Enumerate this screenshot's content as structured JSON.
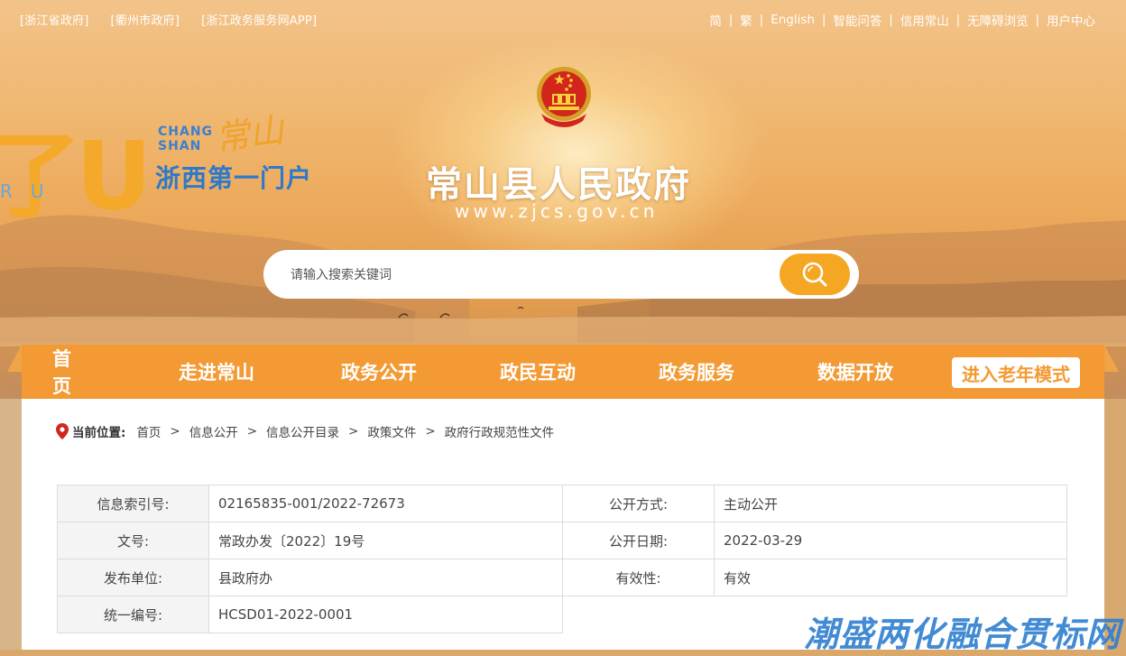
{
  "topbar": {
    "left_links": [
      "[浙江省政府]",
      "[衢州市政府]",
      "[浙江政务服务网APP]"
    ],
    "right_links": [
      "简",
      "繁",
      "English",
      "智能问答",
      "信用常山",
      "无障碍浏览",
      "用户中心"
    ]
  },
  "header": {
    "title": "常山县人民政府",
    "url": "www.zjcs.gov.cn",
    "brand": {
      "big_letters": "了U",
      "small_letters": "RU",
      "chang": "CHANG",
      "shan": "SHAN",
      "hand": "常山",
      "slogan": "浙西第一门户"
    }
  },
  "search": {
    "placeholder": "请输入搜索关键词"
  },
  "nav": {
    "items": [
      "首页",
      "走进常山",
      "政务公开",
      "政民互动",
      "政务服务",
      "数据开放"
    ],
    "elder_mode": "进入老年模式"
  },
  "breadcrumb": {
    "label": "当前位置:",
    "items": [
      "首页",
      "信息公开",
      "信息公开目录",
      "政策文件",
      "政府行政规范性文件"
    ]
  },
  "info_table": {
    "rows": [
      {
        "k1": "信息索引号:",
        "v1": "02165835-001/2022-72673",
        "k2": "公开方式:",
        "v2": "主动公开"
      },
      {
        "k1": "文号:",
        "v1": "常政办发〔2022〕19号",
        "k2": "公开日期:",
        "v2": "2022-03-29"
      },
      {
        "k1": "发布单位:",
        "v1": "县政府办",
        "k2": "有效性:",
        "v2": "有效"
      },
      {
        "k1": "统一编号:",
        "v1": "HCSD01-2022-0001",
        "k2": "",
        "v2": ""
      }
    ]
  },
  "watermark": "潮盛两化融合贯标网",
  "colors": {
    "nav_orange": "#f39a34",
    "search_button": "#f5a623",
    "brand_blue": "#2e79c9"
  }
}
